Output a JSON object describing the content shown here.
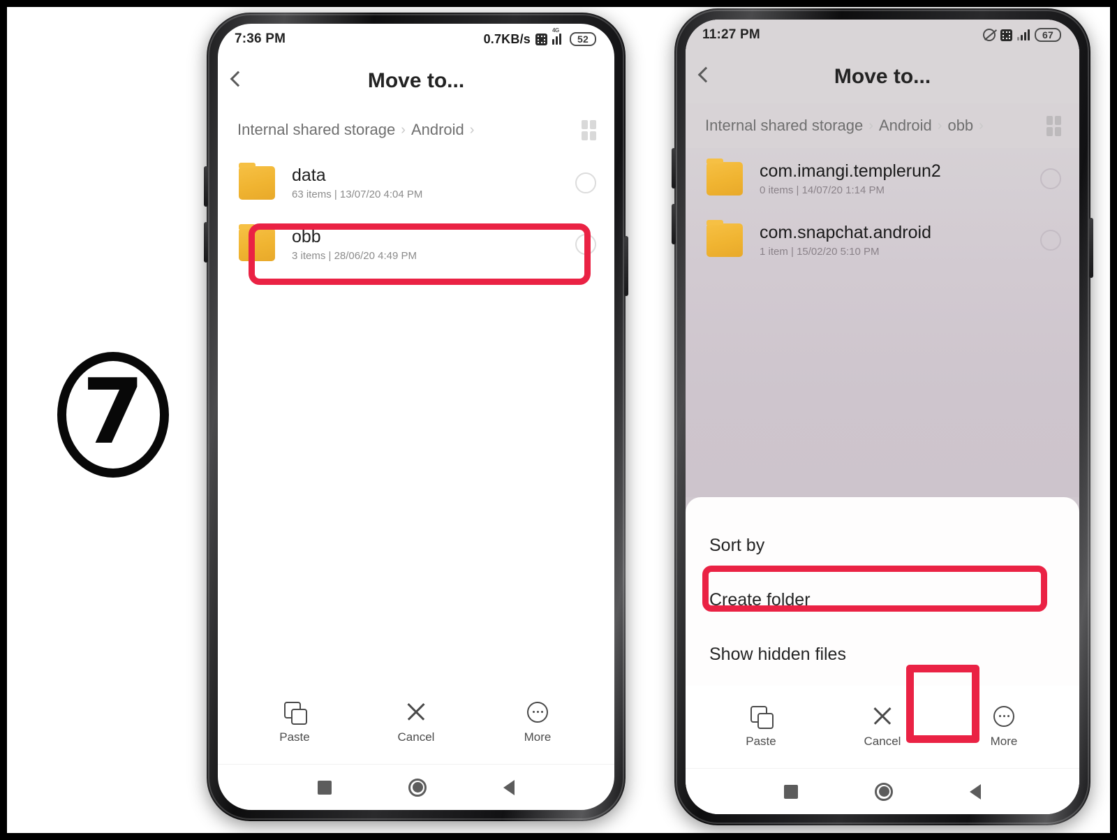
{
  "step": {
    "number": "7"
  },
  "accent": {
    "highlight_red": "#ea2244",
    "folder_yellow": "#f3b733"
  },
  "left_phone": {
    "status": {
      "time": "7:36 PM",
      "net_speed": "0.7KB/s",
      "network_label": "4G",
      "battery": "52",
      "icons": [
        "data-saver-icon",
        "signal-icon",
        "battery-icon"
      ]
    },
    "appbar": {
      "title": "Move to...",
      "back_icon": "back-chevron-icon"
    },
    "breadcrumb": {
      "parts": [
        "Internal shared storage",
        "Android"
      ],
      "separator": "›",
      "trailing_separator": "›",
      "view_toggle_icon": "grid-view-icon"
    },
    "files": [
      {
        "name": "data",
        "meta": "63 items  |  13/07/20 4:04 PM",
        "icon": "folder-icon",
        "selected": false
      },
      {
        "name": "obb",
        "meta": "3 items  |  28/06/20 4:49 PM",
        "icon": "folder-icon",
        "selected": false,
        "highlighted": true
      }
    ],
    "toolbar": [
      {
        "label": "Paste",
        "icon": "paste-icon"
      },
      {
        "label": "Cancel",
        "icon": "close-x-icon"
      },
      {
        "label": "More",
        "icon": "more-dots-icon"
      }
    ],
    "navbar": [
      "recents-square-icon",
      "home-circle-icon",
      "back-triangle-icon"
    ]
  },
  "right_phone": {
    "status": {
      "time": "11:27 PM",
      "battery": "67",
      "icons": [
        "mute-icon",
        "data-saver-icon",
        "signal-icon",
        "battery-icon"
      ]
    },
    "appbar": {
      "title": "Move to...",
      "back_icon": "back-chevron-icon"
    },
    "breadcrumb": {
      "parts": [
        "Internal shared storage",
        "Android",
        "obb"
      ],
      "separator": "›",
      "trailing_separator": "›",
      "view_toggle_icon": "grid-view-icon"
    },
    "files": [
      {
        "name": "com.imangi.templerun2",
        "meta": "0 items  |  14/07/20 1:14 PM",
        "icon": "folder-icon",
        "selected": false
      },
      {
        "name": "com.snapchat.android",
        "meta": "1 item  |  15/02/20 5:10 PM",
        "icon": "folder-icon",
        "selected": false
      }
    ],
    "sheet": {
      "items": [
        {
          "label": "Sort by"
        },
        {
          "label": "Create folder",
          "highlighted": true
        },
        {
          "label": "Show hidden files"
        }
      ]
    },
    "toolbar": [
      {
        "label": "Paste",
        "icon": "paste-icon"
      },
      {
        "label": "Cancel",
        "icon": "close-x-icon"
      },
      {
        "label": "More",
        "icon": "more-dots-icon",
        "highlighted": true
      }
    ],
    "navbar": [
      "recents-square-icon",
      "home-circle-icon",
      "back-triangle-icon"
    ]
  }
}
